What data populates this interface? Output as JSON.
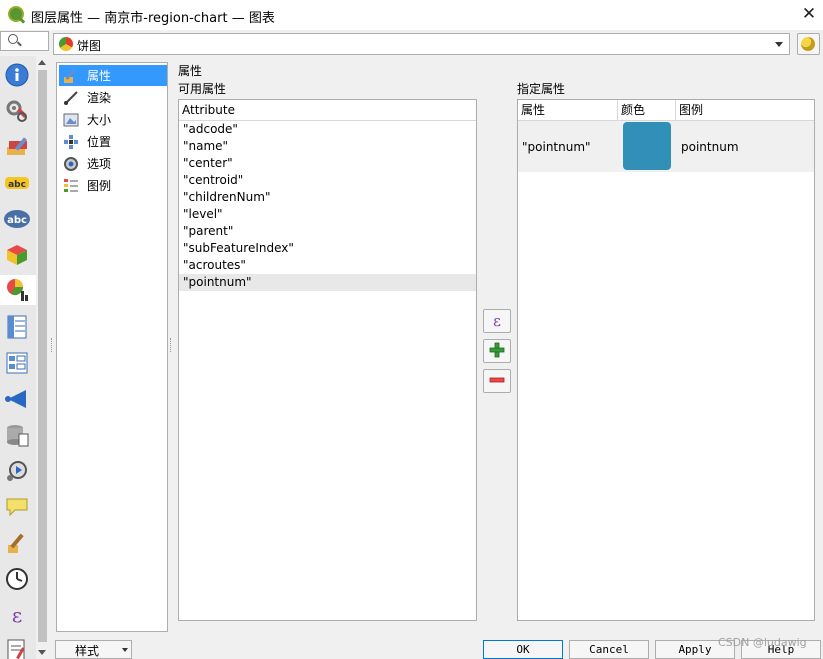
{
  "window": {
    "title": "图层属性 — 南京市-region-chart — 图表",
    "close": "✕"
  },
  "renderer": {
    "selected": "饼图"
  },
  "sidebar": {
    "tool_icons": [
      "info-icon",
      "source-icon",
      "symbology-icon",
      "labels-icon",
      "abc-labels-icon",
      "3d-view-icon",
      "diagrams-icon",
      "fields-icon",
      "attributes-form-icon",
      "joins-icon",
      "auxiliary-storage-icon",
      "actions-icon",
      "display-icon",
      "rendering-icon",
      "temporal-icon",
      "variables-icon",
      "metadata-icon"
    ]
  },
  "categories": [
    {
      "label": "属性",
      "icon": "attributes-brush-icon",
      "selected": true
    },
    {
      "label": "渲染",
      "icon": "rendering-brush-icon",
      "selected": false
    },
    {
      "label": "大小",
      "icon": "size-icon",
      "selected": false
    },
    {
      "label": "位置",
      "icon": "placement-icon",
      "selected": false
    },
    {
      "label": "选项",
      "icon": "options-gear-icon",
      "selected": false
    },
    {
      "label": "图例",
      "icon": "legend-icon",
      "selected": false
    }
  ],
  "attributes_section": {
    "title": "属性",
    "available_label": "可用属性",
    "assigned_label": "指定属性",
    "list_header": "Attribute",
    "fields": [
      "\"adcode\"",
      "\"name\"",
      "\"center\"",
      "\"centroid\"",
      "\"childrenNum\"",
      "\"level\"",
      "\"parent\"",
      "\"subFeatureIndex\"",
      "\"acroutes\"",
      "\"pointnum\""
    ]
  },
  "middle_buttons": {
    "expression": "ε",
    "add": "+",
    "remove": "−"
  },
  "assigned_table": {
    "headers": [
      "属性",
      "颜色",
      "图例"
    ],
    "rows": [
      {
        "attribute": "\"pointnum\"",
        "color": "#3290b8",
        "legend": "pointnum"
      }
    ]
  },
  "footer": {
    "style_menu": "样式",
    "ok": "OK",
    "cancel": "Cancel",
    "apply": "Apply",
    "help": "Help",
    "watermark": "CSDN @ludawig"
  }
}
